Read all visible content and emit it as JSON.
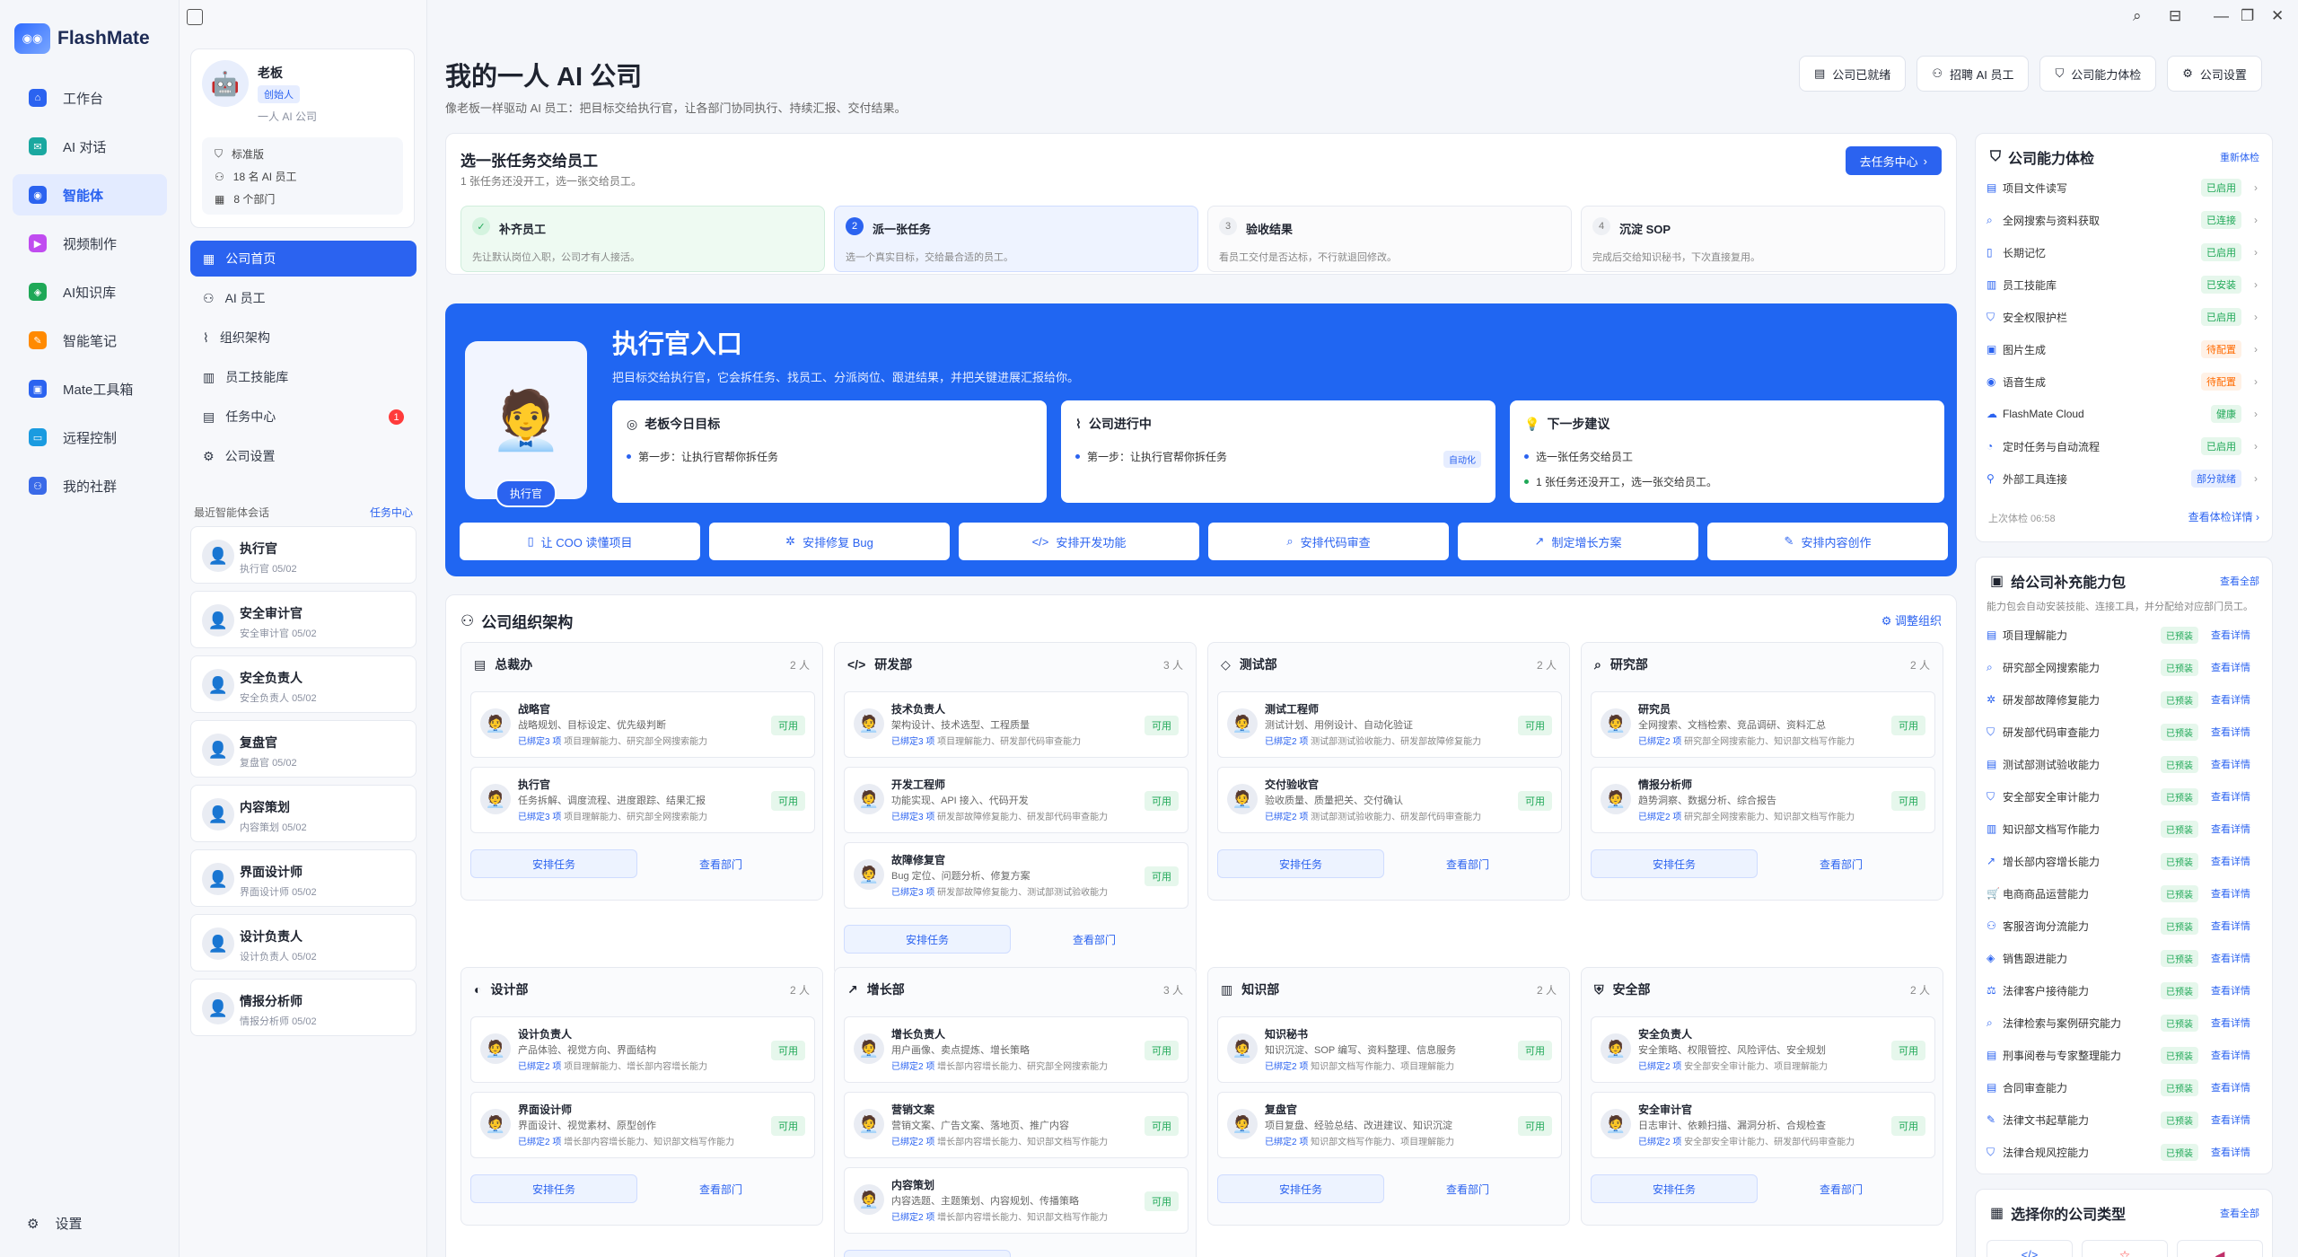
{
  "app": {
    "name": "FlashMate"
  },
  "nav": {
    "items": [
      {
        "label": "工作台",
        "color": "#2b63f0"
      },
      {
        "label": "AI 对话",
        "color": "#1aa8a0"
      },
      {
        "label": "智能体",
        "color": "#2b63f0"
      },
      {
        "label": "视频制作",
        "color": "#c04cf0"
      },
      {
        "label": "AI知识库",
        "color": "#1fa857"
      },
      {
        "label": "智能笔记",
        "color": "#ff8a00"
      },
      {
        "label": "Mate工具箱",
        "color": "#2b63f0"
      },
      {
        "label": "远程控制",
        "color": "#1a9be0"
      },
      {
        "label": "我的社群",
        "color": "#3a6ae8"
      }
    ],
    "settings": "设置"
  },
  "profile": {
    "name": "老板",
    "tag": "创始人",
    "company": "一人 AI 公司",
    "plan": "标准版",
    "employees": "18 名 AI 员工",
    "departments": "8 个部门"
  },
  "menu": [
    {
      "label": "公司首页"
    },
    {
      "label": "AI 员工"
    },
    {
      "label": "组织架构"
    },
    {
      "label": "员工技能库"
    },
    {
      "label": "任务中心",
      "badge": "1"
    },
    {
      "label": "公司设置"
    }
  ],
  "recent": {
    "title": "最近智能体会话",
    "link": "任务中心",
    "items": [
      {
        "name": "执行官",
        "sub": "执行官",
        "date": "05/02"
      },
      {
        "name": "安全审计官",
        "sub": "安全审计官",
        "date": "05/02"
      },
      {
        "name": "安全负责人",
        "sub": "安全负责人",
        "date": "05/02"
      },
      {
        "name": "复盘官",
        "sub": "复盘官",
        "date": "05/02"
      },
      {
        "name": "内容策划",
        "sub": "内容策划",
        "date": "05/02"
      },
      {
        "name": "界面设计师",
        "sub": "界面设计师",
        "date": "05/02"
      },
      {
        "name": "设计负责人",
        "sub": "设计负责人",
        "date": "05/02"
      },
      {
        "name": "情报分析师",
        "sub": "情报分析师",
        "date": "05/02"
      }
    ]
  },
  "header": {
    "title": "我的一人 AI 公司",
    "subtitle": "像老板一样驱动 AI 员工：把目标交给执行官，让各部门协同执行、持续汇报、交付结果。",
    "buttons": [
      "公司已就绪",
      "招聘 AI 员工",
      "公司能力体检",
      "公司设置"
    ]
  },
  "task": {
    "title": "选一张任务交给员工",
    "sub": "1 张任务还没开工，选一张交给员工。",
    "go": "去任务中心",
    "steps": [
      {
        "num": "✓",
        "name": "补齐员工",
        "desc": "先让默认岗位入职，公司才有人接活。"
      },
      {
        "num": "2",
        "name": "派一张任务",
        "desc": "选一个真实目标，交给最合适的员工。"
      },
      {
        "num": "3",
        "name": "验收结果",
        "desc": "看员工交付是否达标，不行就退回修改。"
      },
      {
        "num": "4",
        "name": "沉淀 SOP",
        "desc": "完成后交给知识秘书，下次直接复用。"
      }
    ]
  },
  "exec": {
    "title": "执行官入口",
    "desc": "把目标交给执行官，它会拆任务、找员工、分派岗位、跟进结果，并把关键进展汇报给你。",
    "label": "执行官",
    "boxes": [
      {
        "title": "老板今日目标",
        "lines": [
          "第一步：让执行官帮你拆任务"
        ]
      },
      {
        "title": "公司进行中",
        "lines": [
          "第一步：让执行官帮你拆任务"
        ],
        "chip": "自动化"
      },
      {
        "title": "下一步建议",
        "lines": [
          "选一张任务交给员工",
          "1 张任务还没开工，选一张交给员工。"
        ]
      }
    ],
    "quick": [
      "让 COO 读懂项目",
      "安排修复 Bug",
      "安排开发功能",
      "安排代码审查",
      "制定增长方案",
      "安排内容创作"
    ]
  },
  "org": {
    "title": "公司组织架构",
    "adjust": "调整组织",
    "assign": "安排任务",
    "view": "查看部门",
    "ok": "可用",
    "bind": "已绑定",
    "depts": [
      {
        "name": "总裁办",
        "count": "2 人",
        "icon": "▤",
        "emps": [
          {
            "n": "战略官",
            "d": "战略规划、目标设定、优先级判断",
            "k": "3 项",
            "s": "项目理解能力、研究部全网搜索能力"
          },
          {
            "n": "执行官",
            "d": "任务拆解、调度流程、进度跟踪、结果汇报",
            "k": "3 项",
            "s": "项目理解能力、研究部全网搜索能力"
          }
        ]
      },
      {
        "name": "研发部",
        "count": "3 人",
        "icon": "</>",
        "emps": [
          {
            "n": "技术负责人",
            "d": "架构设计、技术选型、工程质量",
            "k": "3 项",
            "s": "项目理解能力、研发部代码审查能力"
          },
          {
            "n": "开发工程师",
            "d": "功能实现、API 接入、代码开发",
            "k": "3 项",
            "s": "研发部故障修复能力、研发部代码审查能力"
          },
          {
            "n": "故障修复官",
            "d": "Bug 定位、问题分析、修复方案",
            "k": "3 项",
            "s": "研发部故障修复能力、测试部测试验收能力"
          }
        ]
      },
      {
        "name": "测试部",
        "count": "2 人",
        "icon": "◇",
        "emps": [
          {
            "n": "测试工程师",
            "d": "测试计划、用例设计、自动化验证",
            "k": "2 项",
            "s": "测试部测试验收能力、研发部故障修复能力"
          },
          {
            "n": "交付验收官",
            "d": "验收质量、质量把关、交付确认",
            "k": "2 项",
            "s": "测试部测试验收能力、研发部代码审查能力"
          }
        ]
      },
      {
        "name": "研究部",
        "count": "2 人",
        "icon": "⌕",
        "emps": [
          {
            "n": "研究员",
            "d": "全网搜索、文档检索、竞品调研、资料汇总",
            "k": "2 项",
            "s": "研究部全网搜索能力、知识部文档写作能力"
          },
          {
            "n": "情报分析师",
            "d": "趋势洞察、数据分析、综合报告",
            "k": "2 项",
            "s": "研究部全网搜索能力、知识部文档写作能力"
          }
        ]
      },
      {
        "name": "设计部",
        "count": "2 人",
        "icon": "◐",
        "emps": [
          {
            "n": "设计负责人",
            "d": "产品体验、视觉方向、界面结构",
            "k": "2 项",
            "s": "项目理解能力、增长部内容增长能力"
          },
          {
            "n": "界面设计师",
            "d": "界面设计、视觉素材、原型创作",
            "k": "2 项",
            "s": "增长部内容增长能力、知识部文档写作能力"
          }
        ]
      },
      {
        "name": "增长部",
        "count": "3 人",
        "icon": "↗",
        "emps": [
          {
            "n": "增长负责人",
            "d": "用户画像、卖点提炼、增长策略",
            "k": "2 项",
            "s": "增长部内容增长能力、研究部全网搜索能力"
          },
          {
            "n": "营销文案",
            "d": "营销文案、广告文案、落地页、推广内容",
            "k": "2 项",
            "s": "增长部内容增长能力、知识部文档写作能力"
          },
          {
            "n": "内容策划",
            "d": "内容选题、主题策划、内容规划、传播策略",
            "k": "2 项",
            "s": "增长部内容增长能力、知识部文档写作能力"
          }
        ]
      },
      {
        "name": "知识部",
        "count": "2 人",
        "icon": "▥",
        "emps": [
          {
            "n": "知识秘书",
            "d": "知识沉淀、SOP 编写、资料整理、信息服务",
            "k": "2 项",
            "s": "知识部文档写作能力、项目理解能力"
          },
          {
            "n": "复盘官",
            "d": "项目复盘、经验总结、改进建议、知识沉淀",
            "k": "2 项",
            "s": "知识部文档写作能力、项目理解能力"
          }
        ]
      },
      {
        "name": "安全部",
        "count": "2 人",
        "icon": "⛨",
        "emps": [
          {
            "n": "安全负责人",
            "d": "安全策略、权限管控、风险评估、安全规划",
            "k": "2 项",
            "s": "安全部安全审计能力、项目理解能力"
          },
          {
            "n": "安全审计官",
            "d": "日志审计、依赖扫描、漏洞分析、合规检查",
            "k": "2 项",
            "s": "安全部安全审计能力、研发部代码审查能力"
          }
        ]
      }
    ]
  },
  "caps": {
    "title": "公司能力体检",
    "link": "重新体检",
    "updated": "上次体检 06:58",
    "more": "查看体检详情",
    "items": [
      {
        "n": "项目文件读写",
        "s": "已启用",
        "t": "ok"
      },
      {
        "n": "全网搜索与资料获取",
        "s": "已连接",
        "t": "ok"
      },
      {
        "n": "长期记忆",
        "s": "已启用",
        "t": "ok"
      },
      {
        "n": "员工技能库",
        "s": "已安装",
        "t": "ok"
      },
      {
        "n": "安全权限护栏",
        "s": "已启用",
        "t": "ok"
      },
      {
        "n": "图片生成",
        "s": "待配置",
        "t": "wa"
      },
      {
        "n": "语音生成",
        "s": "待配置",
        "t": "wa"
      },
      {
        "n": "FlashMate Cloud",
        "s": "健康",
        "t": "ok"
      },
      {
        "n": "定时任务与自动流程",
        "s": "已启用",
        "t": "ok"
      },
      {
        "n": "外部工具连接",
        "s": "部分就绪",
        "t": "bl"
      }
    ]
  },
  "packs": {
    "title": "给公司补充能力包",
    "link": "查看全部",
    "sub": "能力包会自动安装技能、连接工具，并分配给对应部门员工。",
    "status": "已预装",
    "detail": "查看详情",
    "items": [
      "项目理解能力",
      "研究部全网搜索能力",
      "研发部故障修复能力",
      "研发部代码审查能力",
      "测试部测试验收能力",
      "安全部安全审计能力",
      "知识部文档写作能力",
      "增长部内容增长能力",
      "电商商品运营能力",
      "客服咨询分流能力",
      "销售跟进能力",
      "法律客户接待能力",
      "法律检索与案例研究能力",
      "刑事阅卷与专家整理能力",
      "合同审查能力",
      "法律文书起草能力",
      "法律合规风控能力"
    ]
  },
  "types": {
    "title": "选择你的公司类型",
    "link": "查看全部"
  }
}
